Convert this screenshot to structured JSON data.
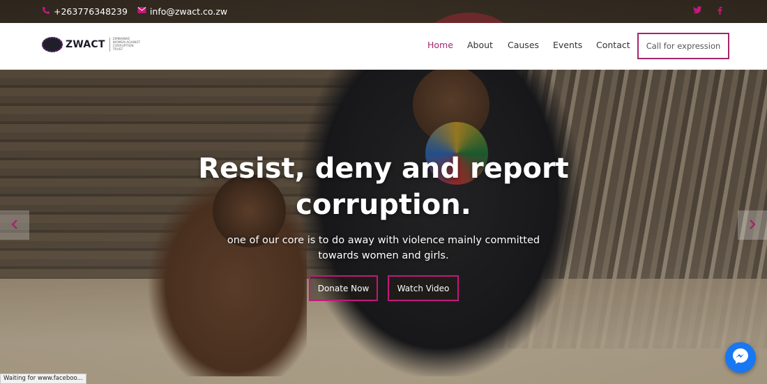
{
  "topbar": {
    "phone": "+263776348239",
    "email": "info@zwact.co.zw",
    "icons": [
      "phone-icon",
      "email-icon",
      "twitter-icon",
      "facebook-icon"
    ]
  },
  "header": {
    "logo_text": "ZWACT",
    "logo_sub": "ZIMBABWE WOMEN AGAINST CORRUPTION TRUST",
    "nav": {
      "home": "Home",
      "about": "About",
      "causes": "Causes",
      "events": "Events",
      "contact": "Contact"
    },
    "cta": "Call for expression"
  },
  "hero": {
    "headline": "Resist, deny and report corruption.",
    "subline": "one of our core is to do away with violence mainly committed towards women and girls.",
    "donate": "Donate Now",
    "watch": "Watch Video"
  },
  "status": "Waiting for www.faceboo...",
  "colors": {
    "accent": "#a3256d",
    "accent_alt": "#c2187b",
    "messenger": "#1877f2"
  }
}
